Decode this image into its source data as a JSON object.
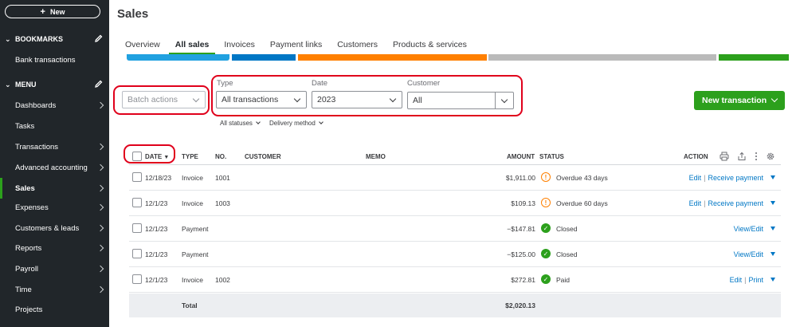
{
  "sidebar": {
    "new_label": "New",
    "bookmarks_label": "BOOKMARKS",
    "bookmark_items": [
      "Bank transactions"
    ],
    "menu_label": "MENU",
    "menu_items": [
      {
        "label": "Dashboards"
      },
      {
        "label": "Tasks"
      },
      {
        "label": "Transactions"
      },
      {
        "label": "Advanced accounting"
      },
      {
        "label": "Sales"
      },
      {
        "label": "Expenses"
      },
      {
        "label": "Customers & leads"
      },
      {
        "label": "Reports"
      },
      {
        "label": "Payroll"
      },
      {
        "label": "Time"
      },
      {
        "label": "Projects"
      }
    ],
    "active_item": "Sales"
  },
  "page": {
    "title": "Sales",
    "tabs": [
      "Overview",
      "All sales",
      "Invoices",
      "Payment links",
      "Customers",
      "Products & services"
    ],
    "active_tab": "All sales"
  },
  "colors": {
    "accent_green": "#2ca01c",
    "highlight_red": "#e0001b",
    "bar_blue_light": "#21a1e0",
    "bar_blue": "#0077c5",
    "bar_orange": "#ff8000",
    "bar_gray": "#bababa"
  },
  "filters": {
    "batch_actions": "Batch actions",
    "type_label": "Type",
    "type_value": "All transactions",
    "date_label": "Date",
    "date_value": "2023",
    "customer_label": "Customer",
    "customer_value": "All",
    "all_statuses": "All statuses",
    "delivery_method": "Delivery method",
    "new_transaction": "New transaction"
  },
  "table": {
    "headers": {
      "date": "DATE",
      "type": "TYPE",
      "no": "NO.",
      "customer": "CUSTOMER",
      "memo": "MEMO",
      "amount": "AMOUNT",
      "status": "STATUS",
      "action": "ACTION"
    },
    "rows": [
      {
        "date": "12/18/23",
        "type": "Invoice",
        "no": "1001",
        "amount": "$1,911.00",
        "status": "Overdue 43 days",
        "status_kind": "overdue",
        "action": "Edit",
        "action2": "Receive payment"
      },
      {
        "date": "12/1/23",
        "type": "Invoice",
        "no": "1003",
        "amount": "$109.13",
        "status": "Overdue 60 days",
        "status_kind": "overdue",
        "action": "Edit",
        "action2": "Receive payment"
      },
      {
        "date": "12/1/23",
        "type": "Payment",
        "no": "",
        "amount": "−$147.81",
        "status": "Closed",
        "status_kind": "ok",
        "action": "View/Edit",
        "action2": ""
      },
      {
        "date": "12/1/23",
        "type": "Payment",
        "no": "",
        "amount": "−$125.00",
        "status": "Closed",
        "status_kind": "ok",
        "action": "View/Edit",
        "action2": ""
      },
      {
        "date": "12/1/23",
        "type": "Invoice",
        "no": "1002",
        "amount": "$272.81",
        "status": "Paid",
        "status_kind": "ok",
        "action": "Edit",
        "action2": "Print"
      }
    ],
    "total_label": "Total",
    "total_amount": "$2,020.13"
  }
}
